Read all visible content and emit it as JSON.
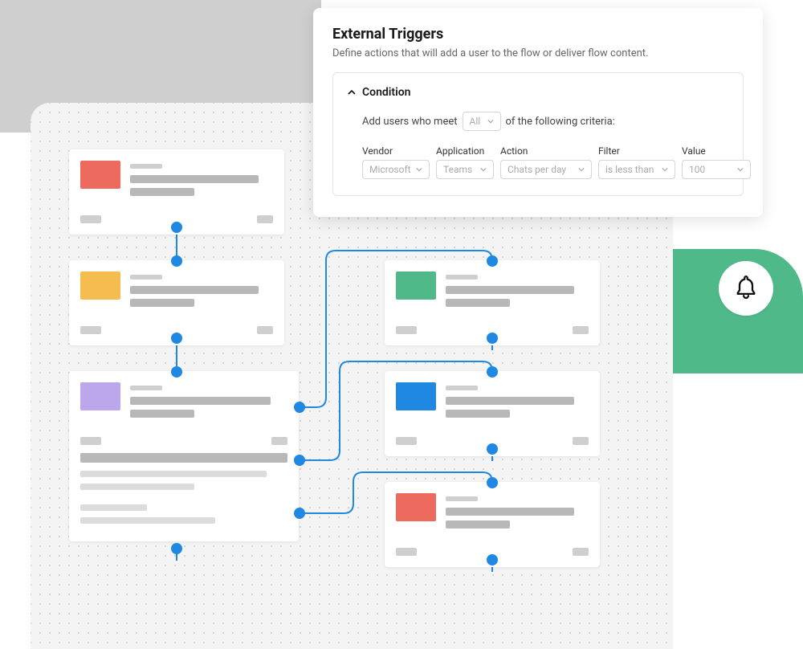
{
  "panel": {
    "title": "External Triggers",
    "desc": "Define actions that will add a user to the flow or deliver flow content.",
    "condition_label": "Condition",
    "sentence_pre": "Add users who meet",
    "sentence_mid": "All",
    "sentence_post": "of the following criteria:",
    "fields": {
      "vendor": {
        "label": "Vendor",
        "value": "Microsoft"
      },
      "application": {
        "label": "Application",
        "value": "Teams"
      },
      "action": {
        "label": "Action",
        "value": "Chats per day"
      },
      "filter": {
        "label": "Filter",
        "value": "is less than"
      },
      "value": {
        "label": "Value",
        "value": "100"
      }
    }
  },
  "colors": {
    "red": "#ed6a5e",
    "yellow": "#f5bd4f",
    "purple": "#bda7ec",
    "green": "#50b98a",
    "blue": "#1e88e2"
  },
  "canvas": {
    "cards_left": [
      "red",
      "yellow",
      "purple"
    ],
    "cards_right": [
      "green",
      "blue",
      "red"
    ]
  }
}
